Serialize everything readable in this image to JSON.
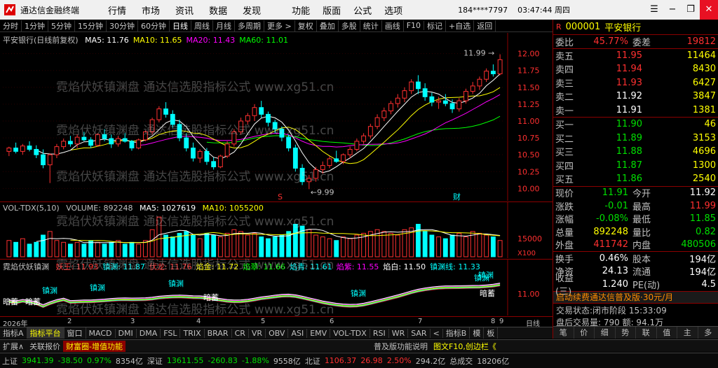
{
  "app": {
    "title": "通达信金融终端",
    "menu": [
      "行情",
      "市场",
      "资讯",
      "数据",
      "发现"
    ],
    "menu2": [
      "功能",
      "版面",
      "公式",
      "选项"
    ],
    "account": "184****7797",
    "clock": "03:47:44 周四"
  },
  "toolbar": [
    "分时",
    "1分钟",
    "5分钟",
    "15分钟",
    "30分钟",
    "60分钟",
    "日线",
    "周线",
    "月线",
    "多周期",
    "更多 >",
    "复权",
    "叠加",
    "多股",
    "统计",
    "画线",
    "F10",
    "标记",
    "+自选",
    "返回"
  ],
  "toolbar_active": "日线",
  "main_chart": {
    "title": "平安银行(日线前复权)",
    "ma": [
      {
        "label": "MA5: 11.76",
        "color": "#ffffff"
      },
      {
        "label": "MA10: 11.65",
        "color": "#ffff00"
      },
      {
        "label": "MA20: 11.43",
        "color": "#ff00ff"
      },
      {
        "label": "MA60: 11.01",
        "color": "#00ff00"
      }
    ],
    "high_label": "11.99",
    "low_label": "9.99",
    "marker_s": "S",
    "marker_cai": "财"
  },
  "chart_data": {
    "type": "candlestick",
    "ylim": [
      9.9,
      12.1
    ],
    "y_ticks": [
      12.0,
      11.75,
      11.5,
      11.25,
      11.0,
      10.75,
      10.5,
      10.25,
      10.0
    ],
    "candles": [
      [
        10.55,
        10.62,
        10.48,
        10.6
      ],
      [
        10.6,
        10.68,
        10.52,
        10.55
      ],
      [
        10.55,
        10.66,
        10.5,
        10.63
      ],
      [
        10.63,
        10.7,
        10.55,
        10.58
      ],
      [
        10.58,
        10.64,
        10.45,
        10.5
      ],
      [
        10.5,
        10.58,
        10.3,
        10.35
      ],
      [
        10.35,
        10.52,
        10.08,
        10.5
      ],
      [
        10.5,
        10.66,
        10.45,
        10.62
      ],
      [
        10.62,
        10.74,
        10.58,
        10.7
      ],
      [
        10.7,
        10.78,
        10.62,
        10.66
      ],
      [
        10.66,
        10.8,
        10.6,
        10.76
      ],
      [
        10.76,
        10.84,
        10.7,
        10.72
      ],
      [
        10.72,
        10.76,
        10.6,
        10.64
      ],
      [
        10.64,
        10.82,
        10.62,
        10.8
      ],
      [
        10.8,
        10.88,
        10.7,
        10.74
      ],
      [
        10.74,
        10.8,
        10.6,
        10.66
      ],
      [
        10.66,
        10.78,
        10.62,
        10.74
      ],
      [
        10.74,
        10.82,
        10.68,
        10.7
      ],
      [
        10.7,
        10.72,
        10.56,
        10.6
      ],
      [
        10.6,
        10.74,
        10.58,
        10.72
      ],
      [
        10.72,
        10.86,
        10.7,
        10.84
      ],
      [
        10.84,
        11.05,
        10.8,
        11.02
      ],
      [
        11.02,
        11.22,
        10.98,
        11.18
      ],
      [
        11.18,
        11.28,
        11.05,
        11.1
      ],
      [
        11.1,
        11.16,
        10.9,
        10.95
      ],
      [
        10.95,
        11.02,
        10.7,
        10.75
      ],
      [
        10.75,
        10.82,
        10.55,
        10.6
      ],
      [
        10.6,
        10.68,
        10.4,
        10.45
      ],
      [
        10.45,
        10.58,
        10.38,
        10.55
      ],
      [
        10.55,
        10.6,
        10.35,
        10.4
      ],
      [
        10.4,
        10.46,
        10.28,
        10.32
      ],
      [
        10.32,
        10.5,
        10.3,
        10.48
      ],
      [
        10.48,
        10.7,
        10.45,
        10.66
      ],
      [
        10.66,
        10.88,
        10.62,
        10.84
      ],
      [
        10.84,
        11.05,
        10.8,
        11.0
      ],
      [
        11.0,
        11.12,
        10.95,
        11.08
      ],
      [
        11.08,
        11.25,
        11.0,
        11.2
      ],
      [
        11.2,
        11.3,
        11.05,
        11.1
      ],
      [
        11.1,
        11.14,
        10.92,
        10.98
      ],
      [
        10.98,
        11.02,
        10.82,
        10.88
      ],
      [
        10.88,
        10.92,
        10.7,
        10.76
      ],
      [
        10.76,
        10.8,
        10.55,
        10.6
      ],
      [
        10.6,
        10.65,
        10.25,
        10.3
      ],
      [
        10.3,
        10.36,
        10.05,
        10.1
      ],
      [
        10.1,
        10.2,
        9.99,
        10.15
      ],
      [
        10.15,
        10.32,
        10.1,
        10.28
      ],
      [
        10.28,
        10.4,
        10.22,
        10.34
      ],
      [
        10.34,
        10.48,
        10.3,
        10.44
      ],
      [
        10.44,
        10.56,
        10.38,
        10.4
      ],
      [
        10.4,
        10.52,
        10.36,
        10.5
      ],
      [
        10.5,
        10.62,
        10.45,
        10.58
      ],
      [
        10.58,
        10.74,
        10.55,
        10.7
      ],
      [
        10.7,
        10.82,
        10.66,
        10.78
      ],
      [
        10.78,
        10.96,
        10.74,
        10.92
      ],
      [
        10.92,
        11.1,
        10.88,
        11.05
      ],
      [
        11.05,
        11.2,
        11.0,
        11.15
      ],
      [
        11.15,
        11.3,
        11.1,
        11.26
      ],
      [
        11.26,
        11.4,
        11.2,
        11.34
      ],
      [
        11.34,
        11.5,
        11.28,
        11.45
      ],
      [
        11.45,
        11.62,
        11.4,
        11.58
      ],
      [
        11.58,
        11.68,
        11.4,
        11.48
      ],
      [
        11.48,
        11.56,
        11.3,
        11.36
      ],
      [
        11.36,
        11.42,
        11.22,
        11.28
      ],
      [
        11.28,
        11.36,
        11.18,
        11.3
      ],
      [
        11.3,
        11.4,
        11.22,
        11.26
      ],
      [
        11.26,
        11.32,
        11.12,
        11.18
      ],
      [
        11.18,
        11.34,
        11.14,
        11.3
      ],
      [
        11.3,
        11.48,
        11.26,
        11.44
      ],
      [
        11.44,
        11.58,
        11.4,
        11.52
      ],
      [
        11.52,
        11.66,
        11.46,
        11.62
      ],
      [
        11.62,
        11.78,
        11.58,
        11.74
      ],
      [
        11.74,
        11.84,
        11.66,
        11.7
      ],
      [
        11.7,
        11.99,
        11.68,
        11.91
      ]
    ]
  },
  "vol_chart": {
    "title": "VOL-TDX(5,10)",
    "volume": "VOLUME: 892248",
    "ma5": "MA5: 1027619",
    "ma10": "MA10: 1055200",
    "axis_label": "15000",
    "axis_unit": "X100"
  },
  "vol_data": [
    9,
    8,
    10,
    7,
    8,
    12,
    14,
    9,
    8,
    7,
    8,
    7,
    9,
    8,
    7,
    8,
    9,
    7,
    8,
    7,
    9,
    15,
    22,
    12,
    11,
    13,
    14,
    12,
    10,
    13,
    12,
    11,
    13,
    15,
    14,
    12,
    13,
    11,
    10,
    11,
    12,
    14,
    18,
    17,
    15,
    12,
    11,
    10,
    9,
    11,
    10,
    12,
    13,
    14,
    15,
    14,
    13,
    12,
    15,
    16,
    18,
    14,
    12,
    11,
    10,
    12,
    13,
    11,
    14,
    13,
    12,
    11,
    9
  ],
  "ind_chart": {
    "title": "霓焰伏妖镇渊",
    "items": [
      {
        "label": "妖王: 11.93",
        "color": "#ff3030"
      },
      {
        "label": "镇渊: 11.87",
        "color": "#00ffff"
      },
      {
        "label": "伏龙: 11.76",
        "color": "#ff3030"
      },
      {
        "label": "焰金: 11.72",
        "color": "#ffff00"
      },
      {
        "label": "焰翠: 11.66",
        "color": "#00ff00"
      },
      {
        "label": "焰青: 11.61",
        "color": "#00ffff"
      },
      {
        "label": "焰紫: 11.55",
        "color": "#ff00ff"
      },
      {
        "label": "焰白: 11.50",
        "color": "#ffffff"
      },
      {
        "label": "镇渊线: 11.33",
        "color": "#00ffff"
      }
    ],
    "axis_label": "11.00",
    "tags": [
      "镇渊",
      "镇渊",
      "镇渊",
      "镇渊",
      "镇渊",
      "镇渊"
    ],
    "tags_white": [
      "暗蓄",
      "暗蓄",
      "暗蓄",
      "暗蓄"
    ]
  },
  "datebar": {
    "year": "2026年",
    "months": [
      "2",
      "3",
      "4",
      "5",
      "6",
      "7",
      "8",
      "9"
    ],
    "period": "日线"
  },
  "tabs": [
    "指标A",
    "指标平台",
    "窗口",
    "MACD",
    "DMI",
    "DMA",
    "FSL",
    "TRIX",
    "BRAR",
    "CR",
    "VR",
    "OBV",
    "ASI",
    "EMV",
    "VOL-TDX",
    "RSI",
    "WR",
    "SAR",
    "<",
    "指标B",
    "模",
    "板"
  ],
  "tabs_active": "指标平台",
  "infobar": {
    "expand": "扩展∧",
    "link1": "关联报价",
    "link2": "财富圈-增值功能",
    "right1": "普及版功能说明",
    "right2": "图文F10,创边栏《"
  },
  "statusbar": [
    {
      "text": "上证",
      "color": "#c0c0c0"
    },
    {
      "text": "3941.39",
      "color": "#00e000"
    },
    {
      "text": "-38.50",
      "color": "#00e000"
    },
    {
      "text": "0.97%",
      "color": "#00e000"
    },
    {
      "text": "8354亿",
      "color": "#c0c0c0"
    },
    {
      "text": "深证",
      "color": "#c0c0c0"
    },
    {
      "text": "13611.55",
      "color": "#00e000"
    },
    {
      "text": "-260.83",
      "color": "#00e000"
    },
    {
      "text": "-1.88%",
      "color": "#00e000"
    },
    {
      "text": "9558亿",
      "color": "#c0c0c0"
    },
    {
      "text": "北证",
      "color": "#c0c0c0"
    },
    {
      "text": "1106.37",
      "color": "#ff3030"
    },
    {
      "text": "26.98",
      "color": "#ff3030"
    },
    {
      "text": "2.50%",
      "color": "#ff3030"
    },
    {
      "text": "294.2亿",
      "color": "#c0c0c0"
    },
    {
      "text": "总成交",
      "color": "#c0c0c0"
    },
    {
      "text": "18206亿",
      "color": "#c0c0c0"
    }
  ],
  "quote": {
    "code": "000001",
    "name": "平安银行",
    "weibi_label": "委比",
    "weibi": "45.77%",
    "weicha_label": "委差",
    "weicha": "19812",
    "asks": [
      {
        "label": "卖五",
        "price": "11.95",
        "vol": "11464"
      },
      {
        "label": "卖四",
        "price": "11.94",
        "vol": "8430"
      },
      {
        "label": "卖三",
        "price": "11.93",
        "vol": "6427"
      },
      {
        "label": "卖二",
        "price": "11.92",
        "vol": "3847"
      },
      {
        "label": "卖一",
        "price": "11.91",
        "vol": "1381"
      }
    ],
    "bids": [
      {
        "label": "买一",
        "price": "11.90",
        "vol": "46"
      },
      {
        "label": "买二",
        "price": "11.89",
        "vol": "3153"
      },
      {
        "label": "买三",
        "price": "11.88",
        "vol": "4696"
      },
      {
        "label": "买四",
        "price": "11.87",
        "vol": "1300"
      },
      {
        "label": "买五",
        "price": "11.86",
        "vol": "2540"
      }
    ],
    "stats": [
      {
        "l1": "现价",
        "v1": "11.91",
        "c1": "green",
        "l2": "今开",
        "v2": "11.92",
        "c2": "white"
      },
      {
        "l1": "涨跌",
        "v1": "-0.01",
        "c1": "green",
        "l2": "最高",
        "v2": "11.99",
        "c2": "red"
      },
      {
        "l1": "涨幅",
        "v1": "-0.08%",
        "c1": "green",
        "l2": "最低",
        "v2": "11.85",
        "c2": "green"
      },
      {
        "l1": "总量",
        "v1": "892248",
        "c1": "yellow",
        "l2": "量比",
        "v2": "0.82",
        "c2": "green"
      },
      {
        "l1": "外盘",
        "v1": "411742",
        "c1": "red",
        "l2": "内盘",
        "v2": "480506",
        "c2": "green"
      }
    ],
    "stats2": [
      {
        "l1": "换手",
        "v1": "0.46%",
        "l2": "股本",
        "v2": "194亿"
      },
      {
        "l1": "净资",
        "v1": "24.13",
        "l2": "流通",
        "v2": "194亿"
      },
      {
        "l1": "收益(三)",
        "v1": "1.240",
        "l2": "PE(动)",
        "v2": "4.5"
      }
    ],
    "ad": "启动续费通达信普及版·30元/月",
    "status1": "交易状态:闭市阶段 15:33:09",
    "status2": "盘后交易量: 790 额: 94.1万",
    "bottom_tabs": [
      "笔",
      "价",
      "细",
      "势",
      "联",
      "值",
      "主",
      "多"
    ]
  },
  "watermark": "霓焰伏妖镇渊盘 通达信选股指标公式 www.xg51.cn"
}
